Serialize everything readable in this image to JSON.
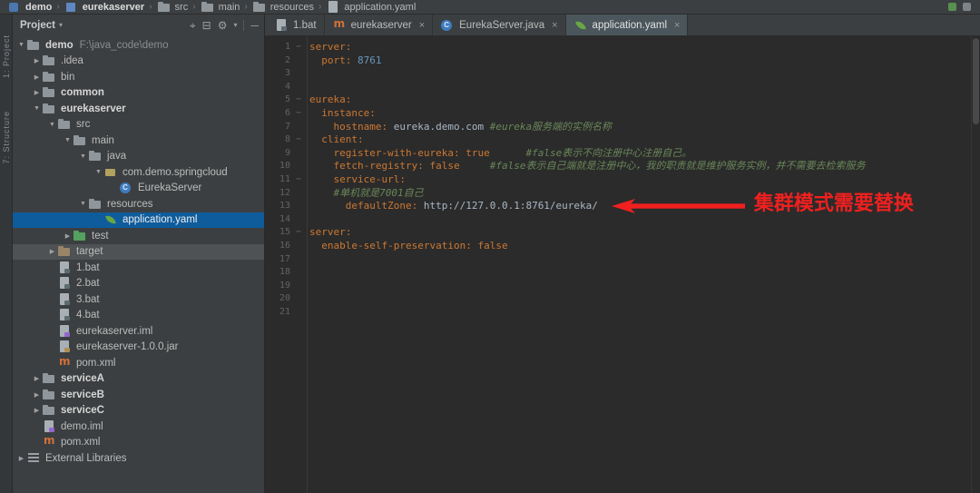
{
  "colors": {
    "selection_blue": "#0f5c9c",
    "annotation_red": "#f0201f",
    "key_orange": "#cc7832",
    "number_blue": "#6897bb",
    "comment_green": "#6a8759"
  },
  "topbar": {
    "breadcrumbs": [
      {
        "label": "demo",
        "icon": "project-icon",
        "bold": true
      },
      {
        "label": "eurekaserver",
        "icon": "module-icon",
        "bold": true
      },
      {
        "label": "src",
        "icon": "folder-icon",
        "bold": false
      },
      {
        "label": "main",
        "icon": "folder-icon",
        "bold": false
      },
      {
        "label": "resources",
        "icon": "folder-icon",
        "bold": false
      },
      {
        "label": "application.yaml",
        "icon": "file-icon",
        "bold": false
      }
    ]
  },
  "tool_stripe": {
    "labels": [
      "1: Project",
      "7: Structure"
    ]
  },
  "project_panel": {
    "title": "Project",
    "header_icons": [
      "select-opened-file-icon",
      "collapse-all-icon",
      "settings-gear-icon",
      "hide-panel-icon"
    ],
    "tree": [
      {
        "label": "demo",
        "extra": "F:\\java_code\\demo",
        "depth": 0,
        "icon": "folder-icon",
        "arrow": "expanded",
        "bold": true
      },
      {
        "label": ".idea",
        "depth": 1,
        "icon": "folder-icon",
        "arrow": "collapsed"
      },
      {
        "label": "bin",
        "depth": 1,
        "icon": "folder-icon",
        "arrow": "collapsed"
      },
      {
        "label": "common",
        "depth": 1,
        "icon": "module-folder-icon",
        "arrow": "collapsed",
        "bold": true
      },
      {
        "label": "eurekaserver",
        "depth": 1,
        "icon": "module-folder-icon",
        "arrow": "expanded",
        "bold": true
      },
      {
        "label": "src",
        "depth": 2,
        "icon": "folder-icon",
        "arrow": "expanded"
      },
      {
        "label": "main",
        "depth": 3,
        "icon": "folder-icon",
        "arrow": "expanded"
      },
      {
        "label": "java",
        "depth": 4,
        "icon": "java-folder-icon",
        "arrow": "expanded"
      },
      {
        "label": "com.demo.springcloud",
        "depth": 5,
        "icon": "package-icon",
        "arrow": "expanded"
      },
      {
        "label": "EurekaServer",
        "depth": 6,
        "icon": "class-icon",
        "arrow": null
      },
      {
        "label": "resources",
        "depth": 4,
        "icon": "resources-folder-icon",
        "arrow": "expanded"
      },
      {
        "label": "application.yaml",
        "depth": 5,
        "icon": "spring-leaf-icon",
        "arrow": null,
        "selected": true
      },
      {
        "label": "test",
        "depth": 3,
        "icon": "test-folder-icon",
        "arrow": "collapsed"
      },
      {
        "label": "target",
        "depth": 2,
        "icon": "target-folder-icon",
        "arrow": "collapsed",
        "highlighted": true
      },
      {
        "label": "1.bat",
        "depth": 2,
        "icon": "bat-file-icon",
        "arrow": null
      },
      {
        "label": "2.bat",
        "depth": 2,
        "icon": "bat-file-icon",
        "arrow": null
      },
      {
        "label": "3.bat",
        "depth": 2,
        "icon": "bat-file-icon",
        "arrow": null
      },
      {
        "label": "4.bat",
        "depth": 2,
        "icon": "bat-file-icon",
        "arrow": null
      },
      {
        "label": "eurekaserver.iml",
        "depth": 2,
        "icon": "iml-file-icon",
        "arrow": null
      },
      {
        "label": "eurekaserver-1.0.0.jar",
        "depth": 2,
        "icon": "jar-file-icon",
        "arrow": null
      },
      {
        "label": "pom.xml",
        "depth": 2,
        "icon": "maven-icon",
        "arrow": null
      },
      {
        "label": "serviceA",
        "depth": 1,
        "icon": "module-folder-icon",
        "arrow": "collapsed",
        "bold": true
      },
      {
        "label": "serviceB",
        "depth": 1,
        "icon": "module-folder-icon",
        "arrow": "collapsed",
        "bold": true
      },
      {
        "label": "serviceC",
        "depth": 1,
        "icon": "module-folder-icon",
        "arrow": "collapsed",
        "bold": true
      },
      {
        "label": "demo.iml",
        "depth": 1,
        "icon": "iml-file-icon",
        "arrow": null
      },
      {
        "label": "pom.xml",
        "depth": 1,
        "icon": "maven-icon",
        "arrow": null
      },
      {
        "label": "External Libraries",
        "depth": 0,
        "icon": "library-icon",
        "arrow": "collapsed"
      }
    ]
  },
  "editor": {
    "tabs": [
      {
        "label": "1.bat",
        "icon": "bat-file-icon",
        "active": false,
        "closable": false
      },
      {
        "label": "eurekaserver",
        "icon": "maven-icon",
        "active": false,
        "closable": true
      },
      {
        "label": "EurekaServer.java",
        "icon": "class-icon",
        "active": false,
        "closable": true
      },
      {
        "label": "application.yaml",
        "icon": "spring-leaf-icon",
        "active": true,
        "closable": true
      }
    ],
    "annotation": {
      "line": 13,
      "text": "集群模式需要替换"
    },
    "lines": [
      {
        "n": 1,
        "fold": true,
        "segs": [
          [
            "server:",
            "k"
          ]
        ]
      },
      {
        "n": 2,
        "segs": [
          [
            "  ",
            "p"
          ],
          [
            "port:",
            "k"
          ],
          [
            " ",
            "p"
          ],
          [
            "8761",
            "n"
          ]
        ]
      },
      {
        "n": 3,
        "segs": []
      },
      {
        "n": 4,
        "segs": []
      },
      {
        "n": 5,
        "fold": true,
        "segs": [
          [
            "eureka:",
            "k"
          ]
        ]
      },
      {
        "n": 6,
        "fold": true,
        "segs": [
          [
            "  ",
            "p"
          ],
          [
            "instance:",
            "k"
          ]
        ]
      },
      {
        "n": 7,
        "segs": [
          [
            "    ",
            "p"
          ],
          [
            "hostname:",
            "k"
          ],
          [
            " ",
            "p"
          ],
          [
            "eureka.demo.com ",
            "v"
          ],
          [
            "#eureka服务端的实例名称",
            "c"
          ]
        ]
      },
      {
        "n": 8,
        "fold": true,
        "segs": [
          [
            "  ",
            "p"
          ],
          [
            "client:",
            "k"
          ]
        ]
      },
      {
        "n": 9,
        "segs": [
          [
            "    ",
            "p"
          ],
          [
            "register-with-eureka:",
            "k"
          ],
          [
            " ",
            "p"
          ],
          [
            "true",
            "b"
          ],
          [
            "      ",
            "p"
          ],
          [
            "#false表示不向注册中心注册自己。",
            "c"
          ]
        ]
      },
      {
        "n": 10,
        "segs": [
          [
            "    ",
            "p"
          ],
          [
            "fetch-registry:",
            "k"
          ],
          [
            " ",
            "p"
          ],
          [
            "false",
            "b"
          ],
          [
            "     ",
            "p"
          ],
          [
            "#false表示自己端就是注册中心，我的职责就是维护服务实例，并不需要去检索服务",
            "c"
          ]
        ]
      },
      {
        "n": 11,
        "fold": true,
        "segs": [
          [
            "    ",
            "p"
          ],
          [
            "service-url:",
            "k"
          ]
        ]
      },
      {
        "n": 12,
        "segs": [
          [
            "    ",
            "p"
          ],
          [
            "#单机就是7001自己",
            "c"
          ]
        ]
      },
      {
        "n": 13,
        "segs": [
          [
            "      ",
            "p"
          ],
          [
            "defaultZone:",
            "k"
          ],
          [
            " ",
            "p"
          ],
          [
            "http://127.0.0.1:8761/eureka/",
            "v"
          ]
        ]
      },
      {
        "n": 14,
        "segs": []
      },
      {
        "n": 15,
        "fold": true,
        "segs": [
          [
            "server:",
            "k"
          ]
        ]
      },
      {
        "n": 16,
        "segs": [
          [
            "  ",
            "p"
          ],
          [
            "enable-self-preservation:",
            "k"
          ],
          [
            " ",
            "p"
          ],
          [
            "false",
            "b"
          ]
        ]
      },
      {
        "n": 17,
        "segs": []
      },
      {
        "n": 18,
        "segs": []
      },
      {
        "n": 19,
        "segs": []
      },
      {
        "n": 20,
        "segs": []
      },
      {
        "n": 21,
        "segs": []
      }
    ]
  }
}
